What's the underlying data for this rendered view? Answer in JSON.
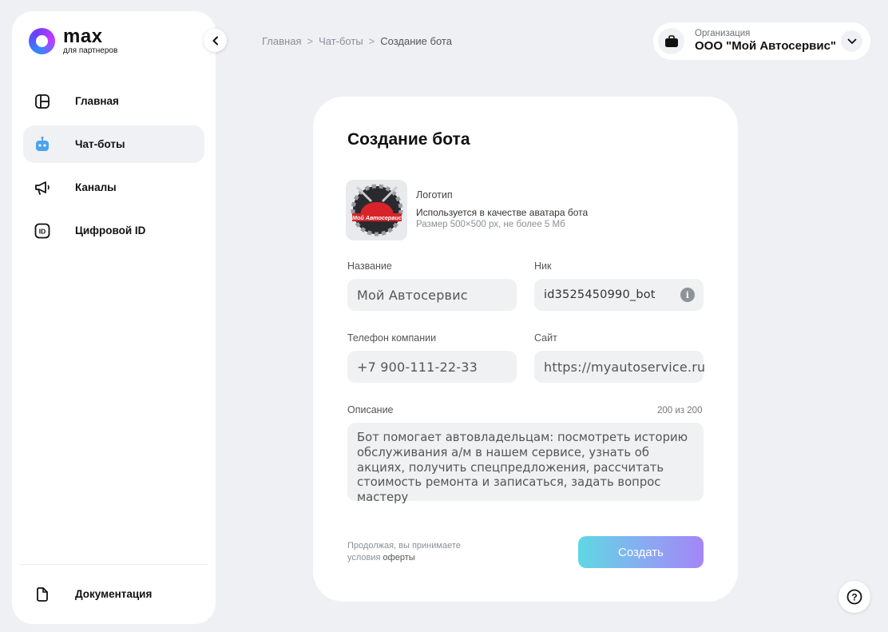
{
  "brand": {
    "name": "max",
    "subtitle": "для партнеров"
  },
  "sidebar": {
    "items": [
      {
        "label": "Главная",
        "icon": "layout-icon",
        "active": false
      },
      {
        "label": "Чат-боты",
        "icon": "bot-icon",
        "active": true
      },
      {
        "label": "Каналы",
        "icon": "megaphone-icon",
        "active": false
      },
      {
        "label": "Цифровой ID",
        "icon": "id-icon",
        "active": false
      }
    ],
    "footer_item": {
      "label": "Документация",
      "icon": "document-icon"
    }
  },
  "breadcrumb": {
    "items": [
      "Главная",
      "Чат-боты",
      "Создание бота"
    ],
    "separator": ">"
  },
  "organization": {
    "label": "Организация",
    "name": "ООО \"Мой Автосервис\""
  },
  "form": {
    "title": "Создание бота",
    "logo": {
      "label": "Логотип",
      "description": "Используется в качестве аватара бота",
      "hint": "Размер 500×500 px, не более 5 Мб",
      "image_text": "Мой Автосервис"
    },
    "name": {
      "label": "Название",
      "value": "Мой Автосервис"
    },
    "nick": {
      "label": "Ник",
      "value": "id3525450990_bot"
    },
    "phone": {
      "label": "Телефон компании",
      "value": "+7 900-111-22-33"
    },
    "site": {
      "label": "Сайт",
      "value": "https://myautoservice.ru"
    },
    "description": {
      "label": "Описание",
      "counter": "200 из 200",
      "value": "Бот помогает автовладельцам: посмотреть историю обслуживания а/м в нашем сервисе, узнать об акциях, получить спецпредложения, рассчитать стоимость ремонта и записаться, задать вопрос мастеру"
    },
    "terms_text": "Продолжая, вы принимаете условия",
    "terms_link": "оферты",
    "submit_label": "Создать"
  },
  "help": {
    "label": "?"
  },
  "colors": {
    "accent_start": "#5fd8e3",
    "accent_end": "#a486f6",
    "background": "#eef0f4"
  }
}
